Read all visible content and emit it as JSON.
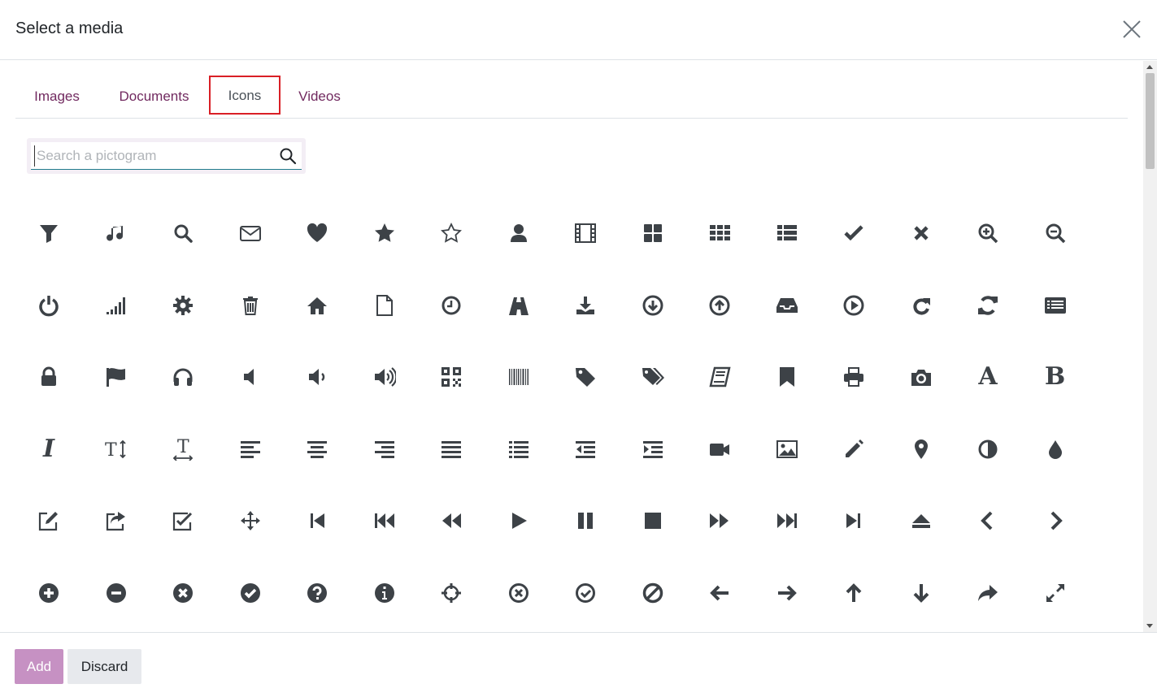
{
  "dialog": {
    "title": "Select a media"
  },
  "tabs": [
    {
      "label": "Images"
    },
    {
      "label": "Documents"
    },
    {
      "label": "Icons",
      "active": true
    },
    {
      "label": "Videos"
    }
  ],
  "search": {
    "placeholder": "Search a pictogram",
    "value": ""
  },
  "icons": [
    [
      "filter",
      "music",
      "search",
      "envelope",
      "heart",
      "star",
      "star-o",
      "user",
      "film",
      "th-large",
      "th",
      "th-list",
      "check",
      "times",
      "search-plus",
      "search-minus"
    ],
    [
      "power-off",
      "signal",
      "cog",
      "trash",
      "home",
      "file-o",
      "clock",
      "road",
      "download",
      "arrow-circle-down",
      "arrow-circle-up",
      "inbox",
      "play-circle",
      "repeat",
      "refresh",
      "list-alt"
    ],
    [
      "lock",
      "flag",
      "headphones",
      "volume-off",
      "volume-down",
      "volume-up",
      "qrcode",
      "barcode",
      "tag",
      "tags",
      "book",
      "bookmark",
      "print",
      "camera",
      "font",
      "bold"
    ],
    [
      "italic",
      "text-height",
      "text-width",
      "align-left",
      "align-center",
      "align-right",
      "align-justify",
      "list",
      "outdent",
      "indent",
      "video-camera",
      "picture",
      "pencil",
      "map-marker",
      "adjust",
      "tint"
    ],
    [
      "edit",
      "share-square",
      "check-square",
      "arrows",
      "step-backward",
      "fast-backward",
      "backward",
      "play",
      "pause",
      "stop",
      "forward",
      "fast-forward",
      "step-forward",
      "eject",
      "chevron-left",
      "chevron-right"
    ],
    [
      "plus-circle",
      "minus-circle",
      "times-circle",
      "check-circle",
      "question-circle",
      "info-circle",
      "crosshairs",
      "times-circle-o",
      "check-circle-o",
      "ban",
      "arrow-left",
      "arrow-right",
      "arrow-up",
      "arrow-down",
      "share",
      "expand"
    ]
  ],
  "buttons": {
    "add": "Add",
    "discard": "Discard"
  },
  "colors": {
    "icon": "#3d4247",
    "tab": "#71295f",
    "primary": "#c691c3",
    "highlight": "#d91f26"
  }
}
